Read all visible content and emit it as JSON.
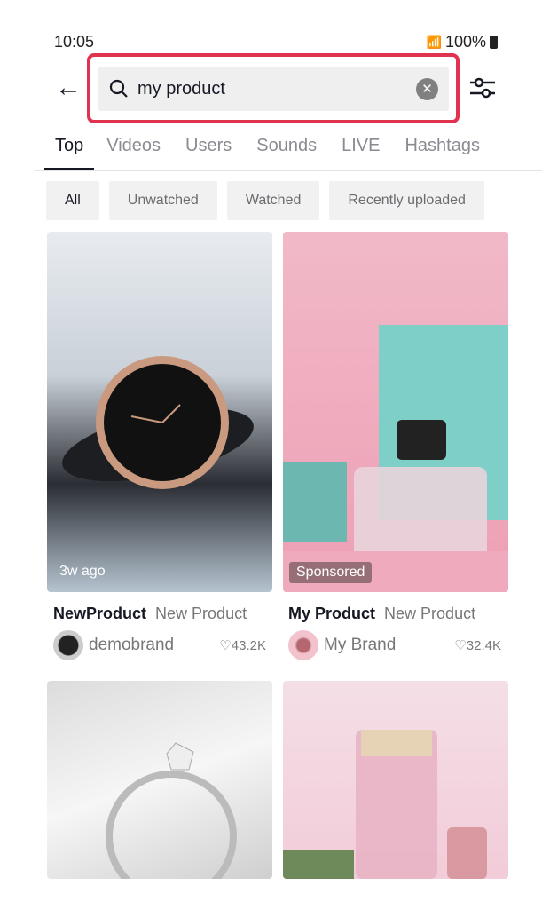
{
  "status": {
    "time": "10:05",
    "battery": "100%"
  },
  "search": {
    "query": "my product"
  },
  "tabs": [
    "Top",
    "Videos",
    "Users",
    "Sounds",
    "LIVE",
    "Hashtags"
  ],
  "chips": [
    "All",
    "Unwatched",
    "Watched",
    "Recently uploaded"
  ],
  "results": [
    {
      "overlay": "3w ago",
      "title": "NewProduct",
      "subtitle": "New Product",
      "author": "demobrand",
      "likes": "43.2K"
    },
    {
      "overlay": "Sponsored",
      "title": "My Product",
      "subtitle": "New Product",
      "author": "My Brand",
      "likes": "32.4K"
    }
  ],
  "colors": {
    "highlight": "#e0334f"
  }
}
